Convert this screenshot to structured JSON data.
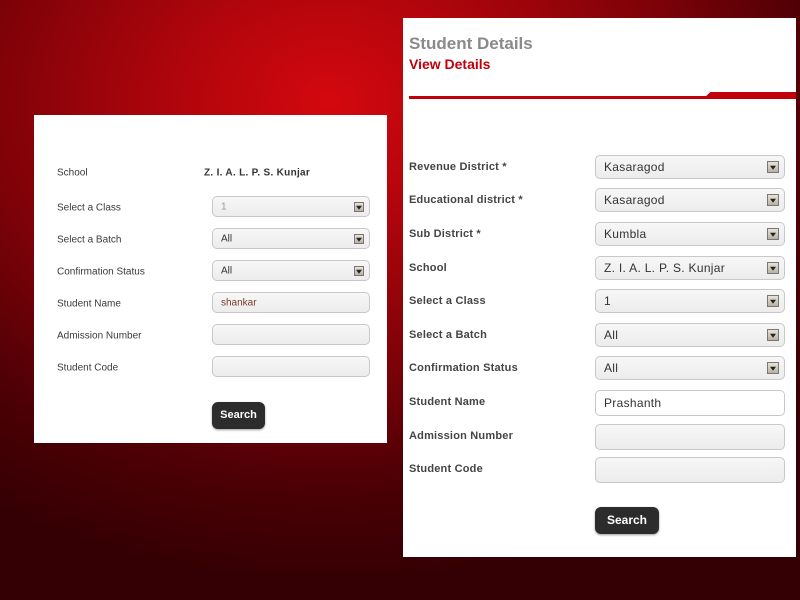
{
  "left_form": {
    "school": {
      "label": "School",
      "value": "Z. I. A. L. P. S. Kunjar"
    },
    "class": {
      "label": "Select a Class",
      "value": "1"
    },
    "batch": {
      "label": "Select a Batch",
      "value": "All"
    },
    "confirmation": {
      "label": "Confirmation Status",
      "value": "All"
    },
    "student_name": {
      "label": "Student Name",
      "value": "shankar"
    },
    "admission": {
      "label": "Admission Number",
      "value": ""
    },
    "student_code": {
      "label": "Student Code",
      "value": ""
    },
    "search_label": "Search"
  },
  "right_form": {
    "title": "Student Details",
    "subtitle": "View Details",
    "revenue_district": {
      "label": "Revenue District *",
      "value": "Kasaragod"
    },
    "educational_district": {
      "label": "Educational district *",
      "value": "Kasaragod"
    },
    "sub_district": {
      "label": "Sub District *",
      "value": "Kumbla"
    },
    "school": {
      "label": "School",
      "value": "Z. I. A. L. P. S. Kunjar"
    },
    "class": {
      "label": "Select a Class",
      "value": "1"
    },
    "batch": {
      "label": "Select a Batch",
      "value": "All"
    },
    "confirmation": {
      "label": "Confirmation Status",
      "value": "All"
    },
    "student_name": {
      "label": "Student Name",
      "value": "Prashanth"
    },
    "admission": {
      "label": "Admission Number",
      "value": ""
    },
    "student_code": {
      "label": "Student Code",
      "value": ""
    },
    "search_label": "Search"
  },
  "colors": {
    "accent": "#c0000a",
    "button": "#2c2c2c",
    "background": "#8a0208"
  },
  "icons": {
    "dropdown": "dropdown-arrow-icon"
  }
}
